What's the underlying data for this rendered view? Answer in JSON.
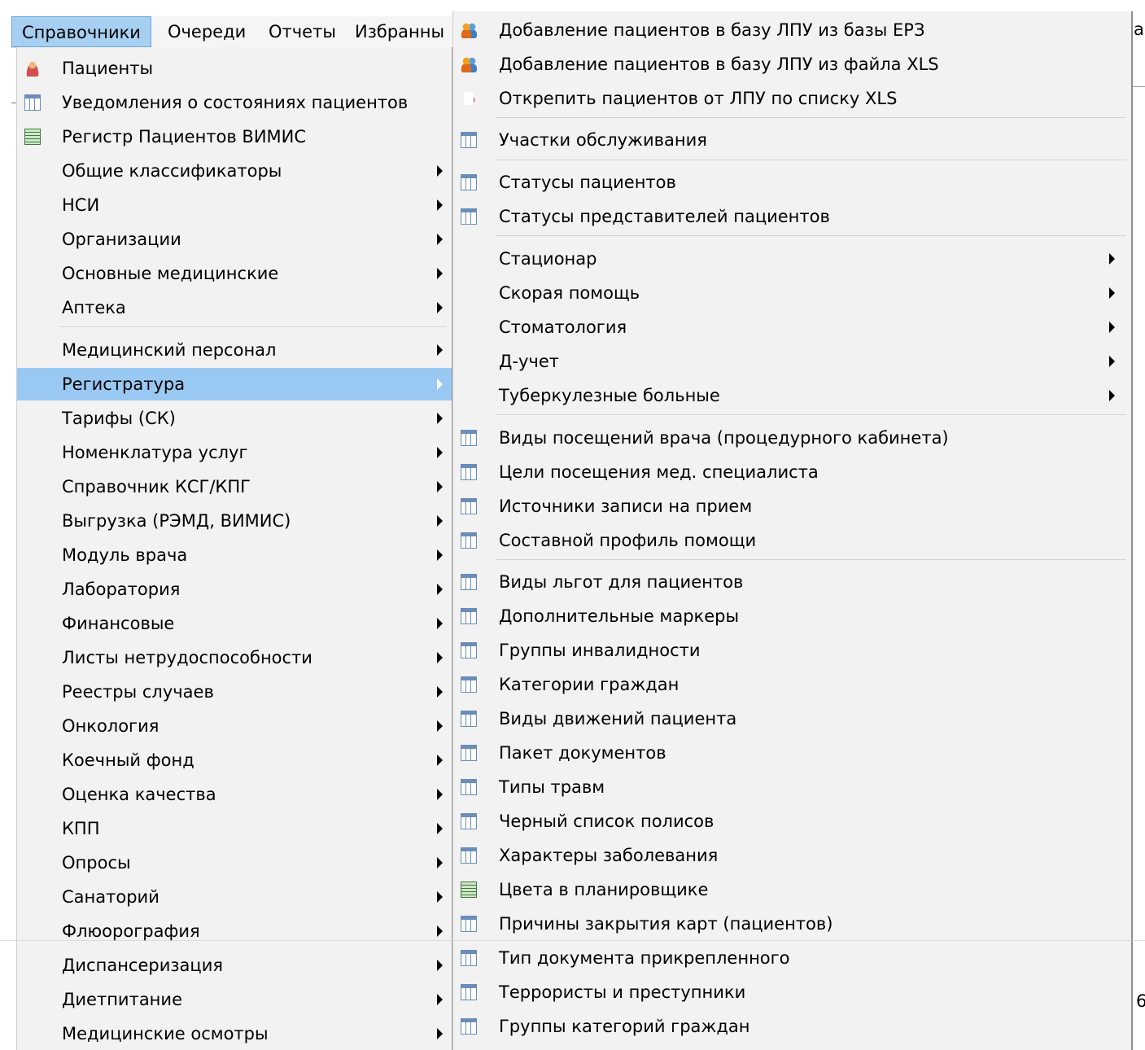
{
  "menubar": {
    "items": [
      "Справочники",
      "Очереди",
      "Отчеты",
      "Избранны"
    ],
    "active_index": 0
  },
  "menu_left": {
    "items": [
      {
        "label": "Пациенты",
        "icon": "user-icon",
        "arrow": false
      },
      {
        "label": "Уведомления о состояниях пациентов",
        "icon": "table-icon",
        "arrow": false
      },
      {
        "label": "Регистр Пациентов ВИМИС",
        "icon": "green-grid-icon",
        "arrow": false
      },
      {
        "label": "Общие классификаторы",
        "icon": "",
        "arrow": true
      },
      {
        "label": "НСИ",
        "icon": "",
        "arrow": true
      },
      {
        "label": "Организации",
        "icon": "",
        "arrow": true
      },
      {
        "label": "Основные медицинские",
        "icon": "",
        "arrow": true
      },
      {
        "label": "Аптека",
        "icon": "",
        "arrow": true
      },
      {
        "label": "Медицинский персонал",
        "icon": "",
        "arrow": true
      },
      {
        "label": "Регистратура",
        "icon": "",
        "arrow": true,
        "highlight": true
      },
      {
        "label": "Тарифы (СК)",
        "icon": "",
        "arrow": true
      },
      {
        "label": "Номенклатура услуг",
        "icon": "",
        "arrow": true
      },
      {
        "label": "Справочник КСГ/КПГ",
        "icon": "",
        "arrow": true
      },
      {
        "label": "Выгрузка (РЭМД, ВИМИС)",
        "icon": "",
        "arrow": true
      },
      {
        "label": "Модуль врача",
        "icon": "",
        "arrow": true
      },
      {
        "label": "Лаборатория",
        "icon": "",
        "arrow": true
      },
      {
        "label": "Финансовые",
        "icon": "",
        "arrow": true
      },
      {
        "label": "Листы нетрудоспособности",
        "icon": "",
        "arrow": true
      },
      {
        "label": "Реестры случаев",
        "icon": "",
        "arrow": true
      },
      {
        "label": "Онкология",
        "icon": "",
        "arrow": true
      },
      {
        "label": "Коечный фонд",
        "icon": "",
        "arrow": true
      },
      {
        "label": "Оценка качества",
        "icon": "",
        "arrow": true
      },
      {
        "label": "КПП",
        "icon": "",
        "arrow": true
      },
      {
        "label": "Опросы",
        "icon": "",
        "arrow": true
      },
      {
        "label": "Санаторий",
        "icon": "",
        "arrow": true
      },
      {
        "label": "Флюорография",
        "icon": "",
        "arrow": true
      },
      {
        "label": "Диспансеризация",
        "icon": "",
        "arrow": true
      },
      {
        "label": "Диетпитание",
        "icon": "",
        "arrow": true
      },
      {
        "label": "Медицинские осмотры",
        "icon": "",
        "arrow": true
      }
    ]
  },
  "menu_right": {
    "items": [
      {
        "label": "Добавление пациентов в базу ЛПУ из базы ЕРЗ",
        "icon": "people-icon",
        "arrow": false
      },
      {
        "label": "Добавление пациентов в базу ЛПУ из файла XLS",
        "icon": "people-icon",
        "arrow": false
      },
      {
        "label": "Открепить пациентов от ЛПУ по списку XLS",
        "icon": "detach-icon",
        "arrow": false
      },
      {
        "label": "Участки обслуживания",
        "icon": "table-icon",
        "arrow": false
      },
      {
        "label": "Статусы пациентов",
        "icon": "table-icon",
        "arrow": false
      },
      {
        "label": "Статусы представителей пациентов",
        "icon": "table-icon",
        "arrow": false
      },
      {
        "label": "Стационар",
        "icon": "",
        "arrow": true
      },
      {
        "label": "Скорая помощь",
        "icon": "",
        "arrow": true
      },
      {
        "label": "Стоматология",
        "icon": "",
        "arrow": true
      },
      {
        "label": "Д-учет",
        "icon": "",
        "arrow": true
      },
      {
        "label": "Туберкулезные больные",
        "icon": "",
        "arrow": true
      },
      {
        "label": "Виды посещений врача (процедурного кабинета)",
        "icon": "table-icon",
        "arrow": false
      },
      {
        "label": "Цели посещения мед. специалиста",
        "icon": "table-icon",
        "arrow": false
      },
      {
        "label": "Источники записи на прием",
        "icon": "table-icon",
        "arrow": false
      },
      {
        "label": "Составной профиль помощи",
        "icon": "table-icon",
        "arrow": false
      },
      {
        "label": "Виды льгот для пациентов",
        "icon": "table-icon",
        "arrow": false
      },
      {
        "label": "Дополнительные маркеры",
        "icon": "table-icon",
        "arrow": false
      },
      {
        "label": "Группы инвалидности",
        "icon": "table-icon",
        "arrow": false
      },
      {
        "label": "Категории граждан",
        "icon": "table-icon",
        "arrow": false
      },
      {
        "label": "Виды движений пациента",
        "icon": "table-icon",
        "arrow": false
      },
      {
        "label": "Пакет документов",
        "icon": "table-icon",
        "arrow": false
      },
      {
        "label": "Типы травм",
        "icon": "table-icon",
        "arrow": false
      },
      {
        "label": "Черный список полисов",
        "icon": "table-icon",
        "arrow": false
      },
      {
        "label": "Характеры заболевания",
        "icon": "table-icon",
        "arrow": false
      },
      {
        "label": "Цвета в планировщике",
        "icon": "green-grid-icon",
        "arrow": false
      },
      {
        "label": "Причины закрытия карт (пациентов)",
        "icon": "table-icon",
        "arrow": false
      },
      {
        "label": "Тип документа прикрепленного",
        "icon": "table-icon",
        "arrow": false
      },
      {
        "label": "Террористы и преступники",
        "icon": "table-icon",
        "arrow": false
      },
      {
        "label": "Группы категорий граждан",
        "icon": "table-icon",
        "arrow": false
      }
    ]
  },
  "edge_fragments": {
    "top_right": "а",
    "bottom_right": "6"
  }
}
